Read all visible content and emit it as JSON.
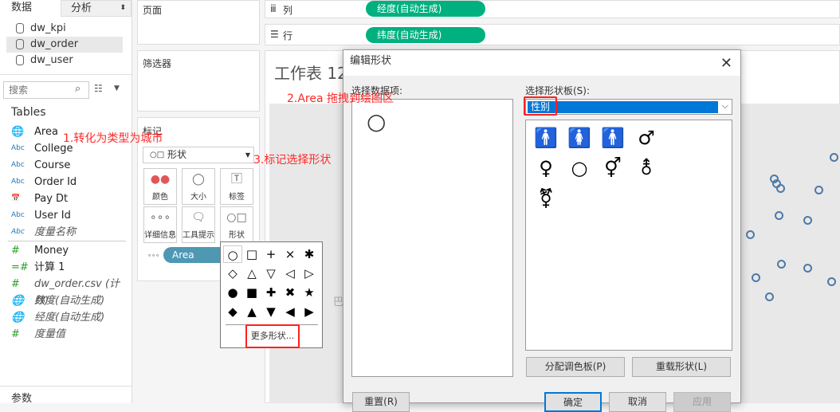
{
  "tabs": {
    "data": "数据",
    "analysis": "分析"
  },
  "datasources": [
    "dw_kpi",
    "dw_order",
    "dw_user"
  ],
  "search": {
    "placeholder": "搜索"
  },
  "tables_label": "Tables",
  "dimensions": [
    {
      "type": "geo",
      "label": "Area"
    },
    {
      "type": "Abc",
      "label": "College"
    },
    {
      "type": "Abc",
      "label": "Course"
    },
    {
      "type": "Abc",
      "label": "Order Id"
    },
    {
      "type": "date",
      "label": "Pay Dt"
    },
    {
      "type": "Abc",
      "label": "User Id"
    },
    {
      "type": "Abc",
      "label": "度量名称"
    }
  ],
  "measures": [
    {
      "type": "#",
      "label": "Money"
    },
    {
      "type": "=#",
      "label": "计算 1"
    },
    {
      "type": "#",
      "label": "dw_order.csv (计数)"
    },
    {
      "type": "geo",
      "label": "纬度(自动生成)"
    },
    {
      "type": "geo",
      "label": "经度(自动生成)"
    },
    {
      "type": "#",
      "label": "度量值"
    }
  ],
  "params_label": "参数",
  "pages_label": "页面",
  "filters_label": "筛选器",
  "marks": {
    "title": "标记",
    "type": "形状",
    "buttons": [
      "颜色",
      "大小",
      "标签",
      "详细信息",
      "工具提示",
      "形状"
    ],
    "pill": "Area"
  },
  "shelves": {
    "columns_label": "列",
    "columns_pill": "经度(自动生成)",
    "rows_label": "行",
    "rows_pill": "纬度(自动生成)"
  },
  "sheet_title": "工作表 12",
  "map_label": "巴基",
  "popup": {
    "shapes": [
      "○",
      "□",
      "+",
      "×",
      "✱",
      "◇",
      "△",
      "▽",
      "◁",
      "▷",
      "●",
      "■",
      "✚",
      "✖",
      "★",
      "◆",
      "▲",
      "▼",
      "◀",
      "▶"
    ],
    "more": "更多形状..."
  },
  "annotations": [
    "1.转化为类型为城市",
    "2.Area 拖拽到绘图区",
    "3.标记选择形状"
  ],
  "dialog": {
    "title": "编辑形状",
    "select_item_label": "选择数据项:",
    "palette_label": "选择形状板(S):",
    "palette_value": "性别",
    "item_shape": "○",
    "palette_shapes": [
      "🚹",
      "🚺",
      "🚹",
      "♂",
      "♀",
      "○",
      "⚥",
      "⚨",
      "⚧"
    ],
    "assign_button": "分配调色板(P)",
    "reload_button": "重载形状(L)",
    "reset_button": "重置(R)",
    "ok_button": "确定",
    "cancel_button": "取消",
    "apply_button": "应用"
  },
  "colors": {
    "pill_green": "#00b07f",
    "area_pill": "#4e98b4",
    "map_dot": "#4e79a7",
    "select_blue": "#0078d7",
    "annotation": "#ff2a2a"
  }
}
